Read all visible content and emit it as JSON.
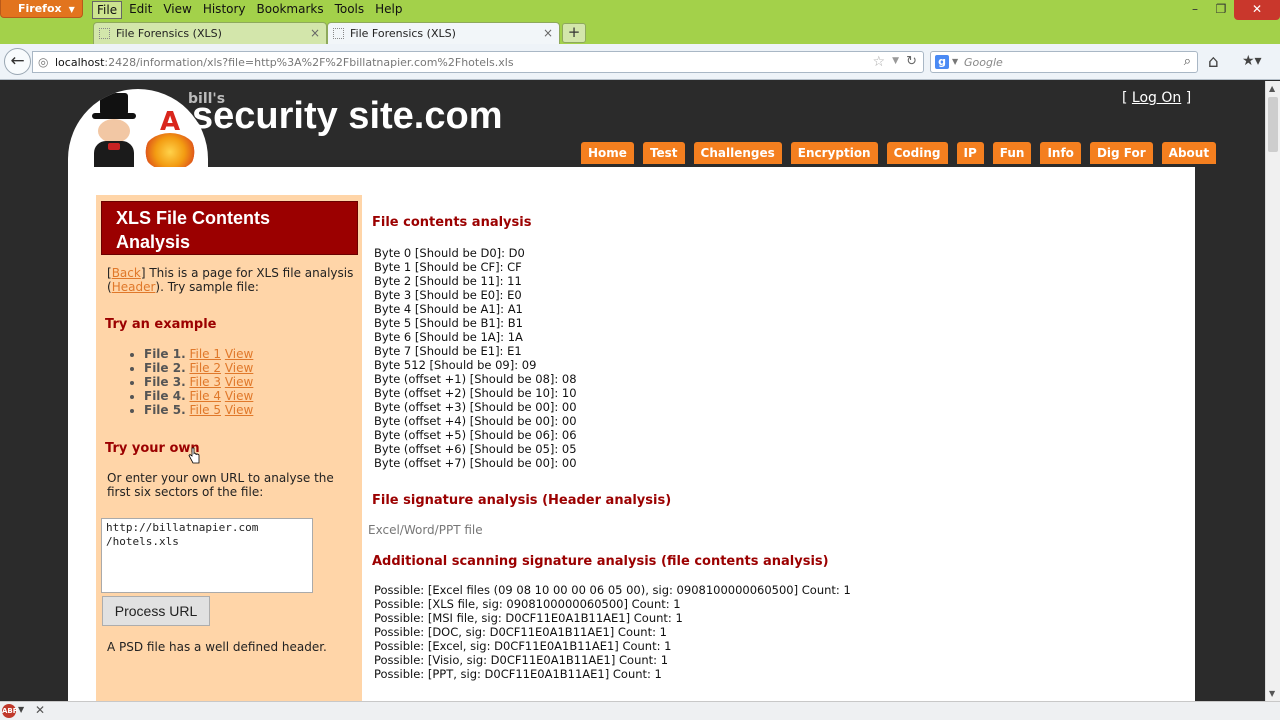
{
  "browser": {
    "app_button": "Firefox",
    "menu": [
      "File",
      "Edit",
      "View",
      "History",
      "Bookmarks",
      "Tools",
      "Help"
    ],
    "tabs": [
      {
        "title": "File Forensics (XLS)"
      },
      {
        "title": "File Forensics (XLS)"
      }
    ],
    "url_host": "localhost",
    "url_rest": ":2428/information/xls?file=http%3A%2F%2Fbillatnapier.com%2Fhotels.xls",
    "search_placeholder": "Google",
    "icons": {
      "back": "back-arrow-icon",
      "reload": "reload-icon",
      "star": "bookmark-star-icon",
      "search": "magnifier-icon",
      "home": "home-icon",
      "bookmarks": "bookmarks-icon"
    }
  },
  "site": {
    "bills": "bill's",
    "name": "security site.com",
    "logon": "Log On",
    "nav": [
      "Home",
      "Test",
      "Challenges",
      "Encryption",
      "Coding",
      "IP",
      "Fun",
      "Info",
      "Dig For",
      "About"
    ],
    "colors": {
      "nav": "#f47f1f",
      "title_box": "#9b0000",
      "sidebar": "#ffd5a8",
      "link": "#e0782a"
    }
  },
  "sidebar": {
    "title": "XLS File Contents Analysis",
    "back_link": "Back",
    "intro_mid": " This is a page for XLS file analysis (",
    "header_link": "Header",
    "intro_end": "). Try sample file:",
    "example_heading": "Try an example",
    "examples": [
      {
        "label": "File 1.",
        "link": "File 1",
        "view": "View"
      },
      {
        "label": "File 2.",
        "link": "File 2",
        "view": "View"
      },
      {
        "label": "File 3.",
        "link": "File 3",
        "view": "View"
      },
      {
        "label": "File 4.",
        "link": "File 4",
        "view": "View"
      },
      {
        "label": "File 5.",
        "link": "File 5",
        "view": "View"
      }
    ],
    "own_heading": "Try your own",
    "own_text": "Or enter your own URL to analyse the first six sectors of the file:",
    "url_value": "http://billatnapier.com\n/hotels.xls",
    "button": "Process URL",
    "note": "A PSD file has a well defined header."
  },
  "main": {
    "contents_heading": "File contents analysis",
    "bytes": [
      "Byte 0 [Should be D0]: D0",
      "Byte 1 [Should be CF]: CF",
      "Byte 2 [Should be 11]: 11",
      "Byte 3 [Should be E0]: E0",
      "Byte 4 [Should be A1]: A1",
      "Byte 5 [Should be B1]: B1",
      "Byte 6 [Should be 1A]: 1A",
      "Byte 7 [Should be E1]: E1",
      "Byte 512 [Should be 09]: 09",
      "Byte (offset +1) [Should be 08]: 08",
      "Byte (offset +2) [Should be 10]: 10",
      "Byte (offset +3) [Should be 00]: 00",
      "Byte (offset +4) [Should be 00]: 00",
      "Byte (offset +5) [Should be 06]: 06",
      "Byte (offset +6) [Should be 05]: 05",
      "Byte (offset +7) [Should be 00]: 00"
    ],
    "signature_heading": "File signature analysis (Header analysis)",
    "signature_result": "Excel/Word/PPT file",
    "scan_heading": "Additional scanning signature analysis (file contents analysis)",
    "scan_results": [
      "Possible: [Excel files (09 08 10 00 00 06 05 00), sig: 0908100000060500] Count: 1",
      "Possible: [XLS file, sig: 0908100000060500] Count: 1",
      "Possible: [MSI file, sig: D0CF11E0A1B11AE1] Count: 1",
      "Possible: [DOC, sig: D0CF11E0A1B11AE1] Count: 1",
      "Possible: [Excel, sig: D0CF11E0A1B11AE1] Count: 1",
      "Possible: [Visio, sig: D0CF11E0A1B11AE1] Count: 1",
      "Possible: [PPT, sig: D0CF11E0A1B11AE1] Count: 1"
    ]
  }
}
